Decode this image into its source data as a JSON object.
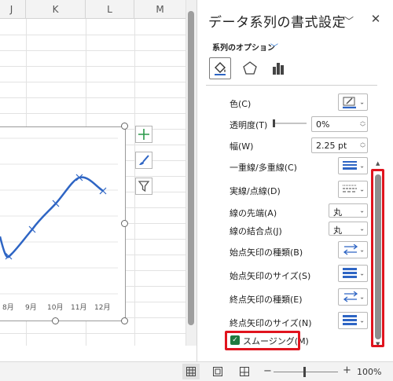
{
  "sheet": {
    "columns": [
      "J",
      "K",
      "L",
      "M"
    ],
    "chart_x_ticks": [
      "8月",
      "9月",
      "10月",
      "11月",
      "12月"
    ]
  },
  "pane": {
    "title": "データ系列の書式設定",
    "series_options_label": "系列のオプション",
    "properties": {
      "color": "色(C)",
      "transparency": "透明度(T)",
      "transparency_value": "0%",
      "width": "幅(W)",
      "width_value": "2.25 pt",
      "compound_type": "一重線/多重線(C)",
      "dash_type": "実線/点線(D)",
      "cap_type": "線の先端(A)",
      "cap_value": "丸",
      "join_type": "線の結合点(J)",
      "join_value": "丸",
      "begin_arrow_type": "始点矢印の種類(B)",
      "begin_arrow_size": "始点矢印のサイズ(S)",
      "end_arrow_type": "終点矢印の種類(E)",
      "end_arrow_size": "終点矢印のサイズ(N)"
    },
    "smoothing_label": "スムージング(M)",
    "smoothing_checked": true
  },
  "status": {
    "zoom": "100%"
  },
  "colors": {
    "accent_blue": "#2e65c4",
    "highlight_red": "#e0141e",
    "check_green": "#1f7a3f"
  }
}
